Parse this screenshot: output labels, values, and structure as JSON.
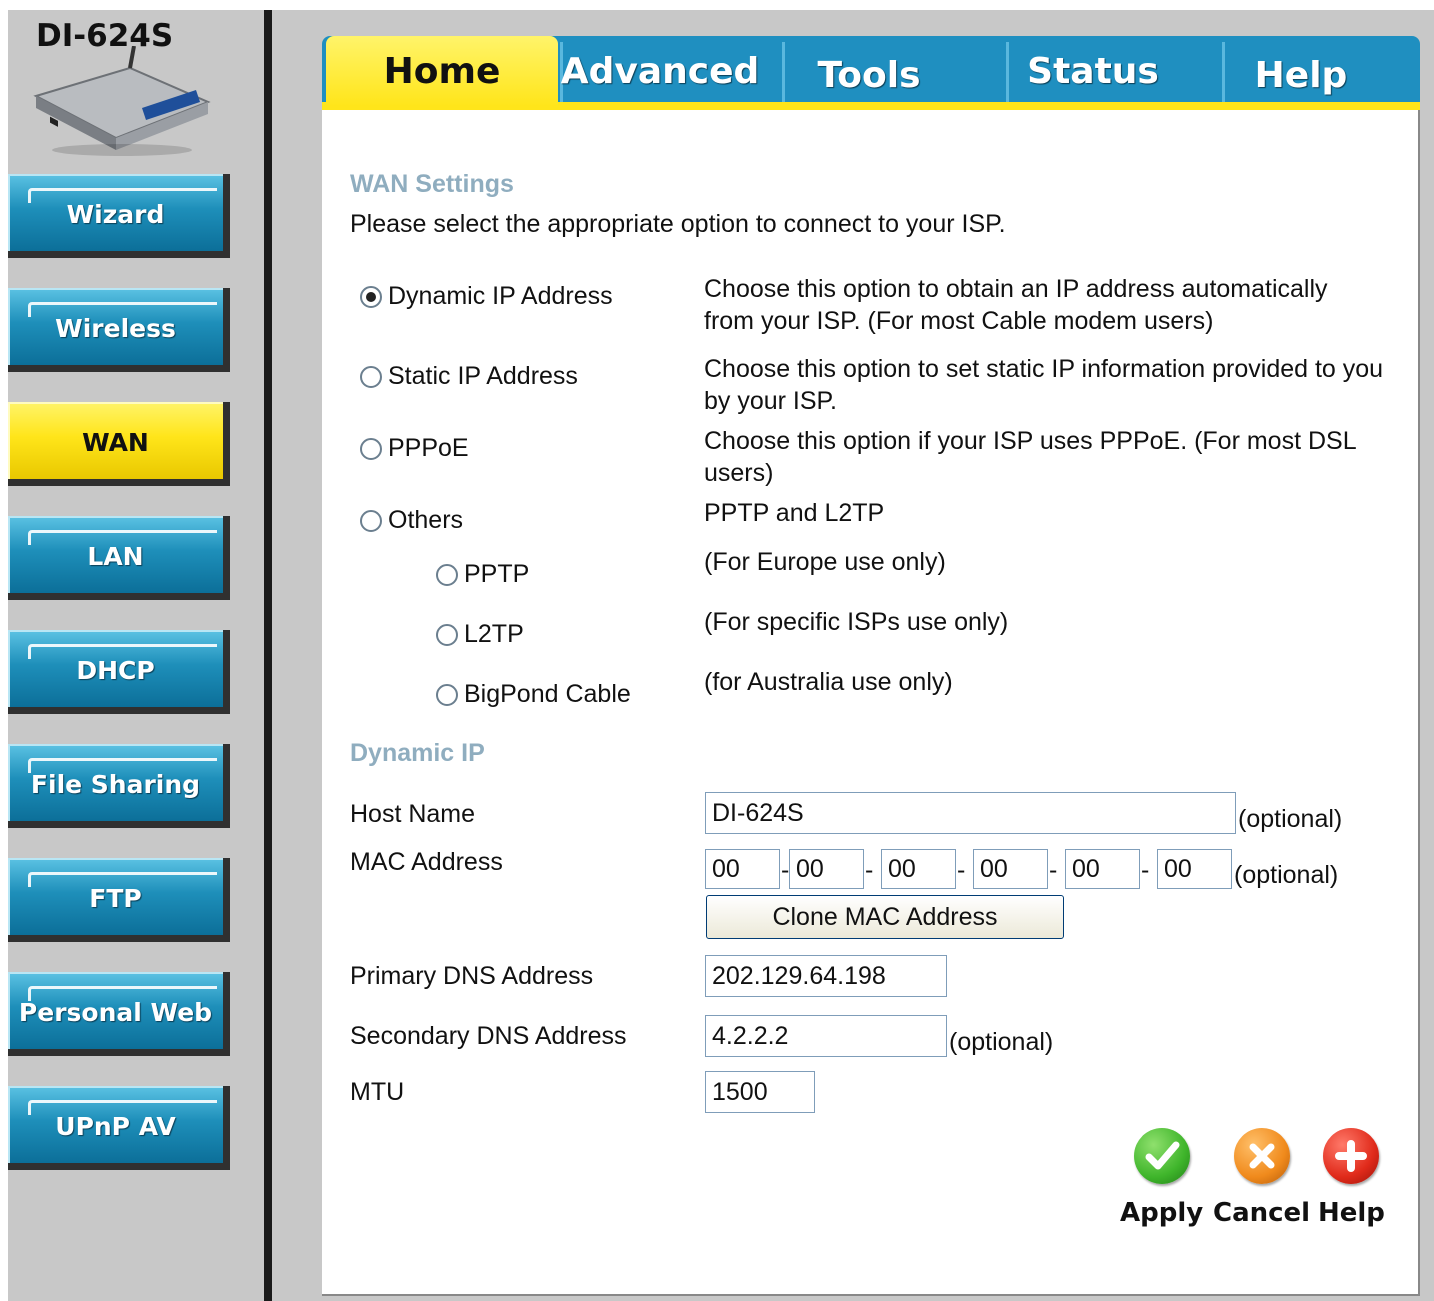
{
  "device": {
    "model": "DI-624S"
  },
  "colors": {
    "accent": "#ffe51a",
    "nav_blue": "#1e8fba",
    "section_title": "#8fadbf",
    "apply_green": "#3fb52b",
    "cancel_orange": "#f08a1c",
    "help_red": "#e02a1a"
  },
  "sidebar": {
    "items": [
      {
        "label": "Wizard",
        "active": false
      },
      {
        "label": "Wireless",
        "active": false
      },
      {
        "label": "WAN",
        "active": true
      },
      {
        "label": "LAN",
        "active": false
      },
      {
        "label": "DHCP",
        "active": false
      },
      {
        "label": "File Sharing",
        "active": false
      },
      {
        "label": "FTP",
        "active": false
      },
      {
        "label": "Personal Web",
        "active": false
      },
      {
        "label": "UPnP AV",
        "active": false
      }
    ]
  },
  "tabs": [
    {
      "label": "Home",
      "active": true
    },
    {
      "label": "Advanced",
      "active": false
    },
    {
      "label": "Tools",
      "active": false
    },
    {
      "label": "Status",
      "active": false
    },
    {
      "label": "Help",
      "active": false
    }
  ],
  "wan": {
    "title": "WAN Settings",
    "intro": "Please select the appropriate option to connect to your ISP.",
    "options": [
      {
        "label": "Dynamic IP Address",
        "checked": true,
        "desc": "Choose this option to obtain an IP address automatically from your ISP. (For most Cable modem users)"
      },
      {
        "label": "Static IP Address",
        "checked": false,
        "desc": "Choose this option to set static IP information provided to you by your ISP."
      },
      {
        "label": "PPPoE",
        "checked": false,
        "desc": "Choose this option if your ISP uses PPPoE. (For most DSL users)"
      },
      {
        "label": "Others",
        "checked": false,
        "desc": "PPTP and L2TP"
      }
    ],
    "sub_options": [
      {
        "label": "PPTP",
        "checked": false,
        "desc": "(For Europe use only)"
      },
      {
        "label": "L2TP",
        "checked": false,
        "desc": "(For specific ISPs use only)"
      },
      {
        "label": "BigPond Cable",
        "checked": false,
        "desc": "(for Australia use only)"
      }
    ]
  },
  "dynamic_ip": {
    "title": "Dynamic IP",
    "host_name": {
      "label": "Host Name",
      "value": "DI-624S",
      "note": "(optional)"
    },
    "mac": {
      "label": "MAC Address",
      "octets": [
        "00",
        "00",
        "00",
        "00",
        "00",
        "00"
      ],
      "note": "(optional)",
      "clone_label": "Clone MAC Address"
    },
    "primary_dns": {
      "label": "Primary DNS Address",
      "value": "202.129.64.198"
    },
    "secondary_dns": {
      "label": "Secondary DNS Address",
      "value": "4.2.2.2",
      "note": "(optional)"
    },
    "mtu": {
      "label": "MTU",
      "value": "1500"
    }
  },
  "actions": {
    "apply": "Apply",
    "cancel": "Cancel",
    "help": "Help"
  }
}
